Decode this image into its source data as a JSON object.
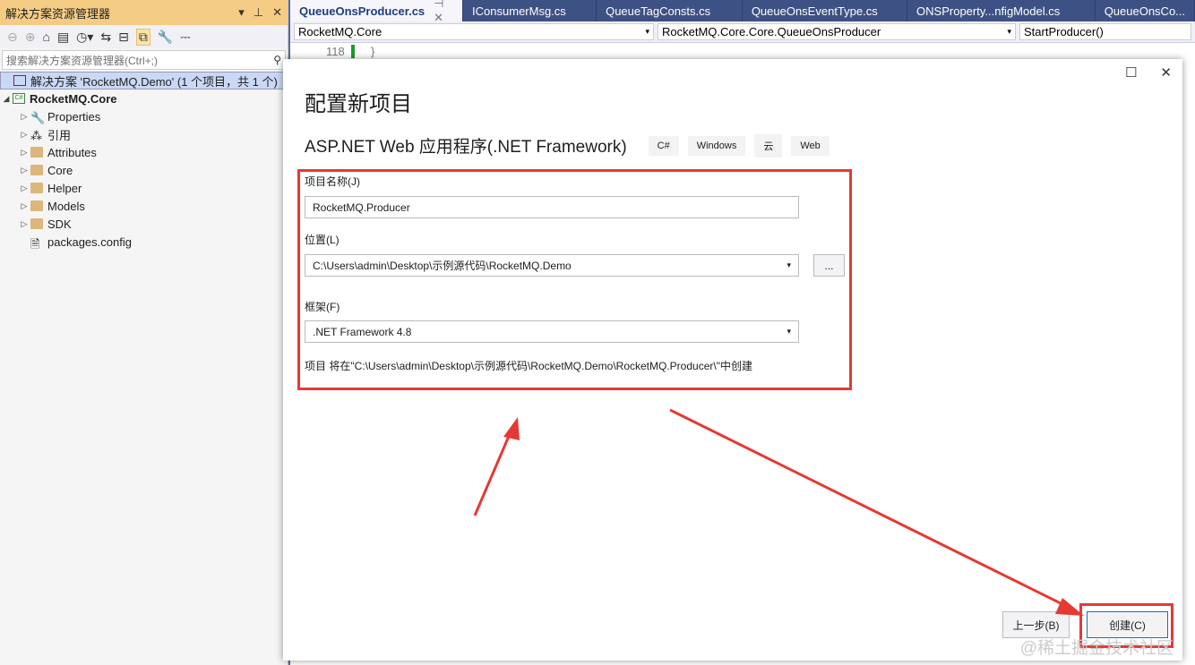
{
  "sidebar": {
    "title": "解决方案资源管理器",
    "search_placeholder": "搜索解决方案资源管理器(Ctrl+;)",
    "solution": "解决方案 'RocketMQ.Demo' (1 个项目，共 1 个)",
    "project": "RocketMQ.Core",
    "items": [
      "Properties",
      "引用",
      "Attributes",
      "Core",
      "Helper",
      "Models",
      "SDK",
      "packages.config"
    ]
  },
  "editor": {
    "tabs": [
      "QueueOnsProducer.cs",
      "IConsumerMsg.cs",
      "QueueTagConsts.cs",
      "QueueOnsEventType.cs",
      "ONSProperty...nfigModel.cs",
      "QueueOnsCo..."
    ],
    "nav": [
      "RocketMQ.Core",
      "RocketMQ.Core.Core.QueueOnsProducer",
      "StartProducer()"
    ],
    "line": "118",
    "code": "}"
  },
  "dialog": {
    "title": "配置新项目",
    "template": "ASP.NET Web 应用程序(.NET Framework)",
    "tags": [
      "C#",
      "Windows",
      "云",
      "Web"
    ],
    "name_label": "项目名称(J)",
    "name_value": "RocketMQ.Producer",
    "location_label": "位置(L)",
    "location_value": "C:\\Users\\admin\\Desktop\\示例源代码\\RocketMQ.Demo",
    "browse": "...",
    "framework_label": "框架(F)",
    "framework_value": ".NET Framework 4.8",
    "info": "项目 将在\"C:\\Users\\admin\\Desktop\\示例源代码\\RocketMQ.Demo\\RocketMQ.Producer\\\"中创建",
    "back": "上一步(B)",
    "create": "创建(C)"
  },
  "watermark": "@稀土掘金技术社区"
}
